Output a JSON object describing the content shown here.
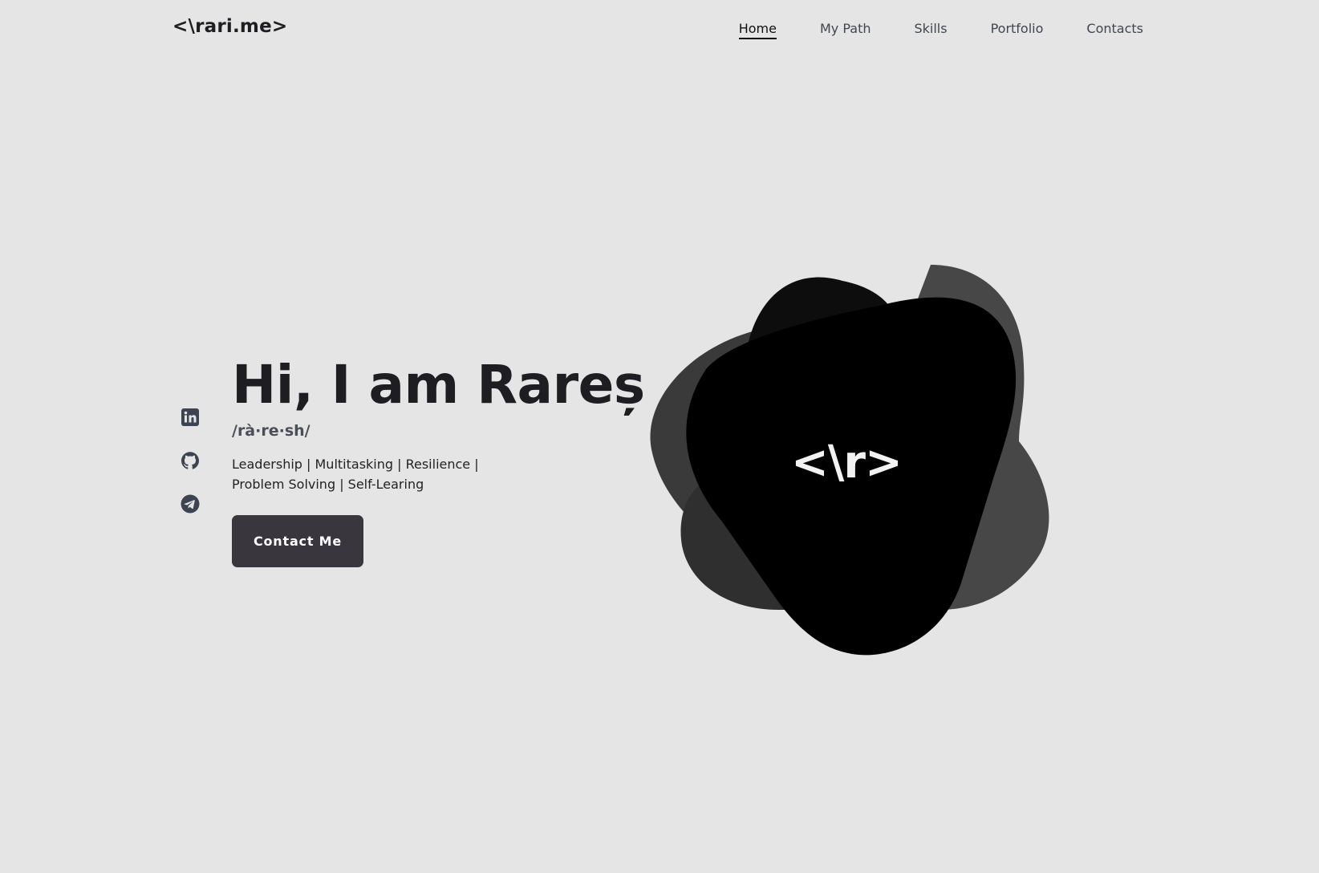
{
  "header": {
    "logo": "<\\rari.me>",
    "nav": [
      {
        "label": "Home",
        "active": true
      },
      {
        "label": "My Path",
        "active": false
      },
      {
        "label": "Skills",
        "active": false
      },
      {
        "label": "Portfolio",
        "active": false
      },
      {
        "label": "Contacts",
        "active": false
      }
    ]
  },
  "socials": [
    {
      "icon": "linkedin-icon"
    },
    {
      "icon": "github-icon"
    },
    {
      "icon": "telegram-icon"
    }
  ],
  "hero": {
    "title": "Hi, I am Rareș",
    "pronunciation": "/rà·re·sh/",
    "description_line1": "Leadership | Multitasking | Resilience |",
    "description_line2": "Problem Solving | Self-Learing",
    "cta_label": "Contact Me"
  },
  "graphic": {
    "mark": "<\\r>",
    "colors": {
      "blob_front": "#000000",
      "blob_back": "#2f2f2f",
      "blob_mid": "#474747"
    }
  },
  "colors": {
    "background": "#e5e5e5",
    "text": "#1e1e22",
    "button": "#39363d"
  }
}
